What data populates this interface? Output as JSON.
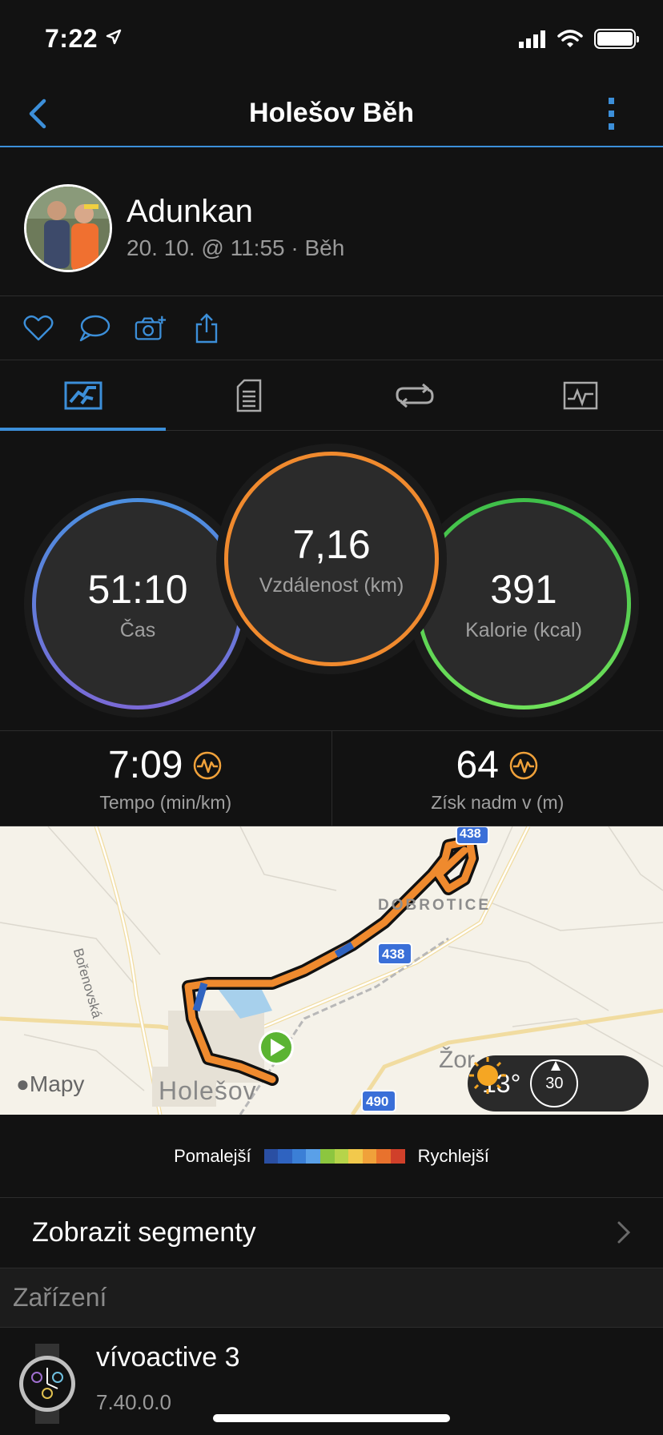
{
  "status": {
    "time": "7:22"
  },
  "nav": {
    "title": "Holešov Běh"
  },
  "profile": {
    "name": "Adunkan",
    "meta": "20. 10. @ 11:55 · Běh"
  },
  "stats": {
    "time": {
      "value": "51:10",
      "label": "Čas"
    },
    "distance": {
      "value": "7,16",
      "label": "Vzdálenost (km)"
    },
    "calories": {
      "value": "391",
      "label": "Kalorie (kcal)"
    }
  },
  "metrics": {
    "pace": {
      "value": "7:09",
      "label": "Tempo (min/km)"
    },
    "ascent": {
      "value": "64",
      "label": "Získ nadm v (m)"
    }
  },
  "map": {
    "labels": {
      "town": "Holešov",
      "village": "DOBROTICE",
      "road": "Bořenovská",
      "partial": "Žor",
      "brand": "Mapy"
    },
    "road_numbers": [
      "438",
      "438",
      "490"
    ],
    "weather": {
      "temp": "13°",
      "wind": "30"
    }
  },
  "legend": {
    "slower": "Pomalejší",
    "faster": "Rychlejší",
    "colors": [
      "#2a4fa3",
      "#2f63c0",
      "#3b7fd6",
      "#5aa0e8",
      "#8cc63f",
      "#b6d44a",
      "#f2c94c",
      "#f0a13a",
      "#e8722d",
      "#d0402a"
    ]
  },
  "segments": {
    "label": "Zobrazit segmenty"
  },
  "devices": {
    "header": "Zařízení",
    "name": "vívoactive 3",
    "version": "7.40.0.0"
  },
  "colors": {
    "accent": "#3c8fd9",
    "distance_ring": "#f08a2e",
    "calorie_ring": "#4ccf4f"
  }
}
